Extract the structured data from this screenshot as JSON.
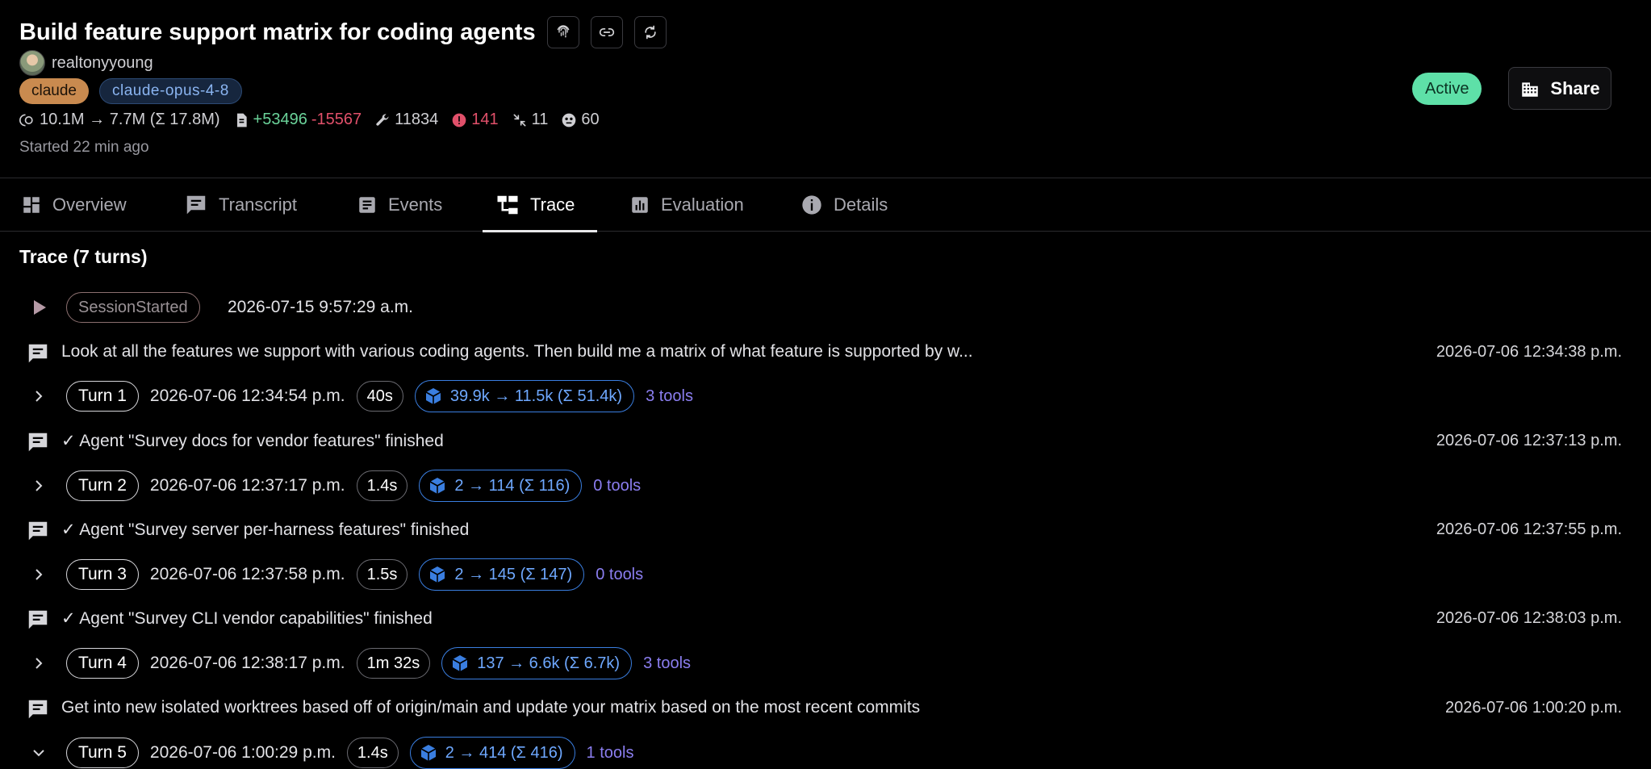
{
  "header": {
    "title": "Build feature support matrix for coding agents",
    "username": "realtonyyoung",
    "tags": [
      "claude",
      "claude-opus-4-8"
    ],
    "stats": {
      "tokens": "10.1M → 7.7M (Σ 17.8M)",
      "additions": "+53496",
      "deletions": "-15567",
      "tool_calls": "11834",
      "errors": "141",
      "compactions": "11",
      "subagents": "60"
    },
    "started": "Started 22 min ago",
    "status": "Active",
    "share_label": "Share",
    "icons": [
      "fingerprint-icon",
      "link-icon",
      "refresh-icon",
      "building-icon"
    ]
  },
  "tabs": [
    {
      "label": "Overview",
      "icon": "dashboard-icon"
    },
    {
      "label": "Transcript",
      "icon": "chat-icon"
    },
    {
      "label": "Events",
      "icon": "list-icon"
    },
    {
      "label": "Trace",
      "icon": "tree-icon",
      "active": true
    },
    {
      "label": "Evaluation",
      "icon": "bar-chart-icon"
    },
    {
      "label": "Details",
      "icon": "info-icon"
    }
  ],
  "trace": {
    "heading": "Trace (7 turns)",
    "session": {
      "label": "SessionStarted",
      "time": "2026-07-15 9:57:29 a.m."
    },
    "messages": [
      {
        "text": "Look at all the features we support with various coding agents. Then build me a matrix of what feature is supported by w...",
        "time": "2026-07-06 12:34:38 p.m."
      },
      {
        "text": "✓ Agent \"Survey docs for vendor features\" finished",
        "time": "2026-07-06 12:37:13 p.m."
      },
      {
        "text": "✓ Agent \"Survey server per-harness features\" finished",
        "time": "2026-07-06 12:37:55 p.m."
      },
      {
        "text": "✓ Agent \"Survey CLI vendor capabilities\" finished",
        "time": "2026-07-06 12:38:03 p.m."
      },
      {
        "text": "Get into new isolated worktrees based off of origin/main and update your matrix based on the most recent commits",
        "time": "2026-07-06 1:00:20 p.m."
      }
    ],
    "turns": [
      {
        "label": "Turn 1",
        "time": "2026-07-06 12:34:54 p.m.",
        "duration": "40s",
        "tokens": "39.9k → 11.5k (Σ 51.4k)",
        "tools": "3 tools",
        "expanded": false
      },
      {
        "label": "Turn 2",
        "time": "2026-07-06 12:37:17 p.m.",
        "duration": "1.4s",
        "tokens": "2 → 114 (Σ 116)",
        "tools": "0 tools",
        "expanded": false
      },
      {
        "label": "Turn 3",
        "time": "2026-07-06 12:37:58 p.m.",
        "duration": "1.5s",
        "tokens": "2 → 145 (Σ 147)",
        "tools": "0 tools",
        "expanded": false
      },
      {
        "label": "Turn 4",
        "time": "2026-07-06 12:38:17 p.m.",
        "duration": "1m 32s",
        "tokens": "137 → 6.6k (Σ 6.7k)",
        "tools": "3 tools",
        "expanded": false
      },
      {
        "label": "Turn 5",
        "time": "2026-07-06 1:00:29 p.m.",
        "duration": "1.4s",
        "tokens": "2 → 414 (Σ 416)",
        "tools": "1 tools",
        "expanded": true
      }
    ]
  },
  "colors": {
    "background": "#000000",
    "active_badge": "#5ee0a8",
    "claude_tag": "#c98a4f",
    "token_blue": "#3a7ee0",
    "tools_purple": "#8b7ef0",
    "additions_green": "#6bd39a",
    "deletions_red": "#e0506a"
  }
}
